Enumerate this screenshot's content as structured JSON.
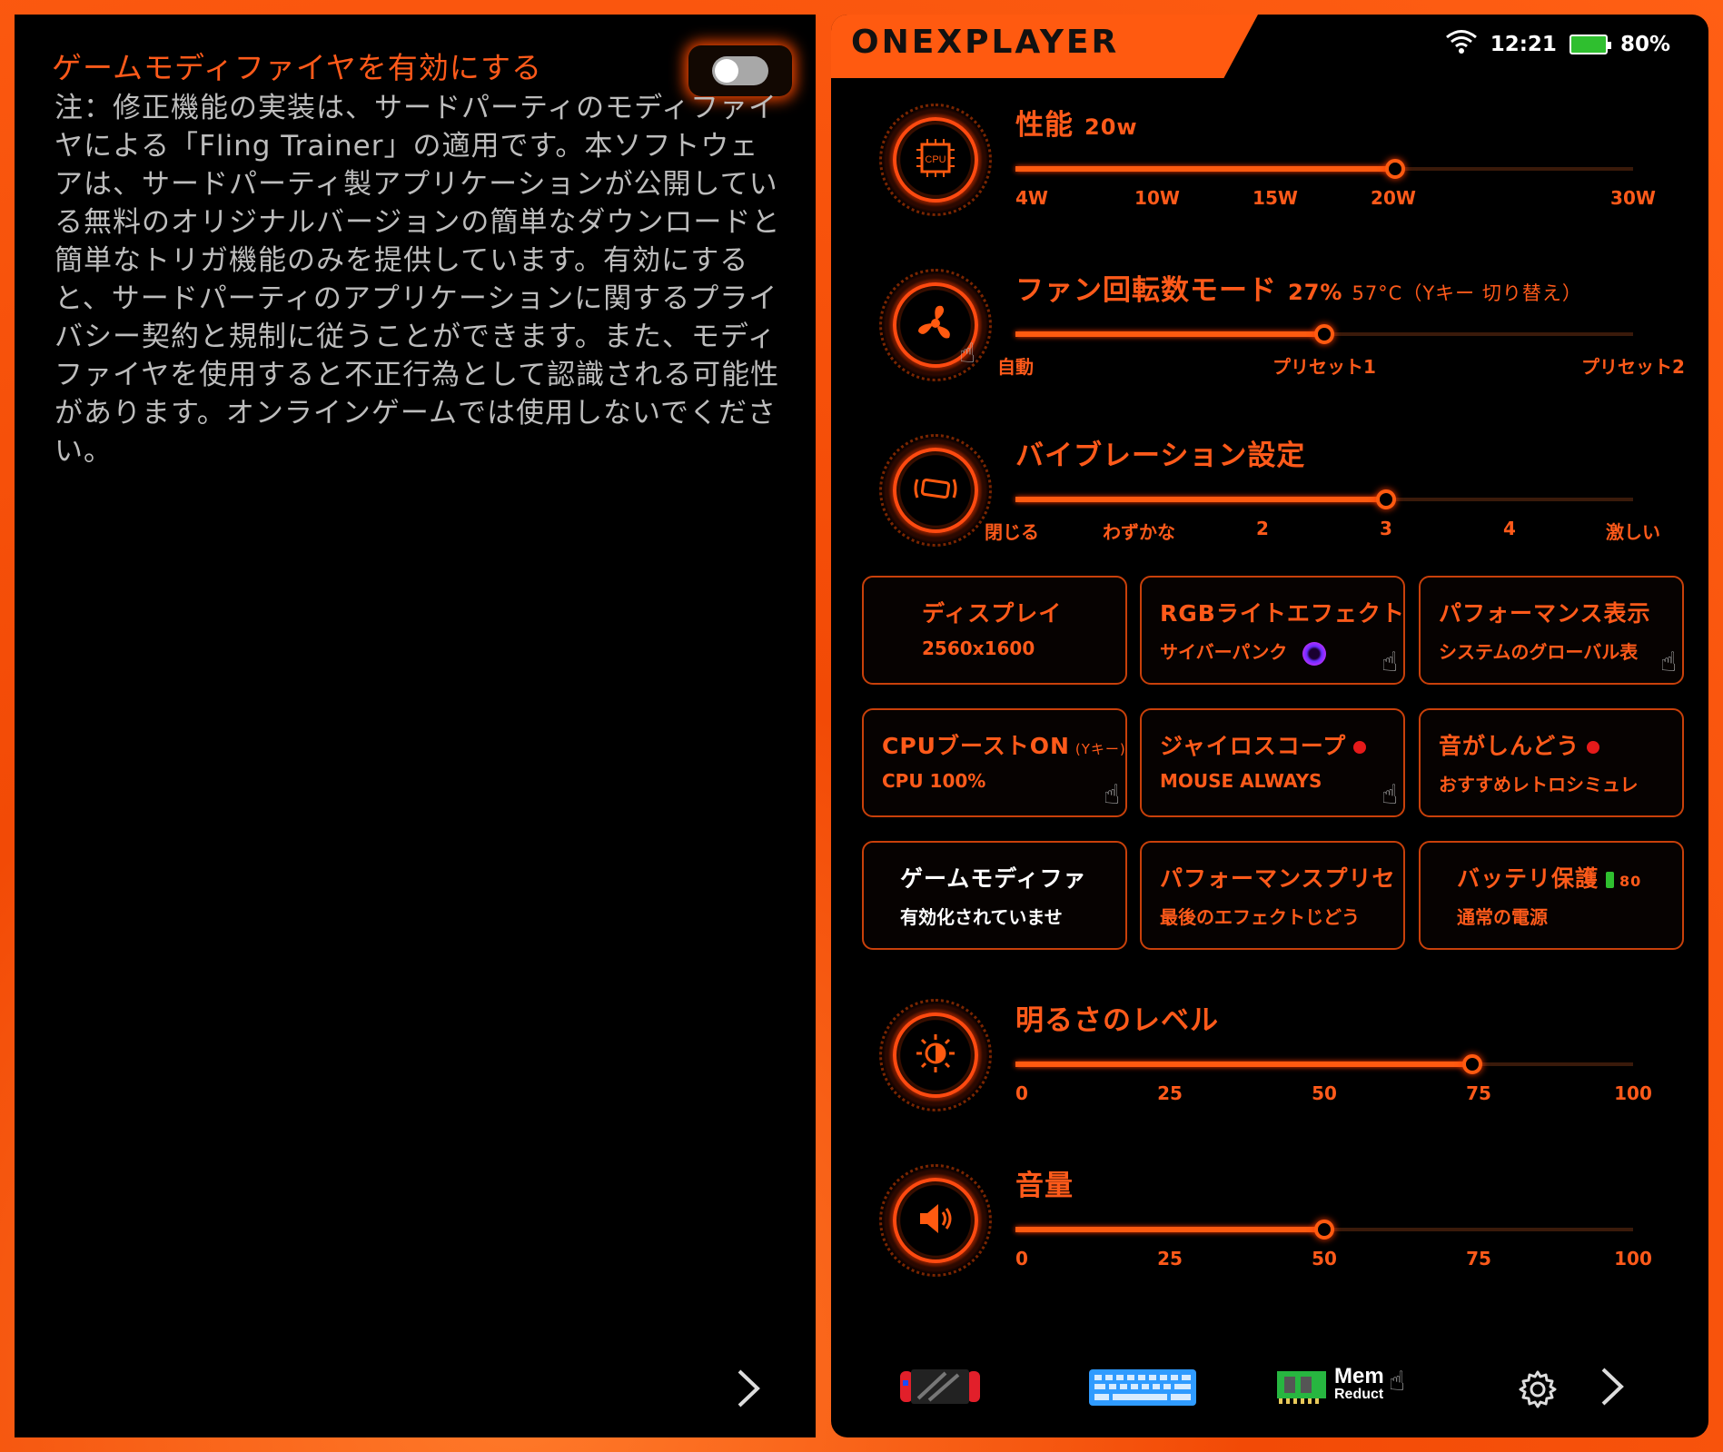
{
  "left": {
    "title": "ゲームモディファイヤを有効にする",
    "toggle_on": false,
    "body": "注：修正機能の実装は、サードパーティのモディファイヤによる「Fling Trainer」の適用です。本ソフトウェアは、サードパーティ製アプリケーションが公開している無料のオリジナルバージョンの簡単なダウンロードと簡単なトリガ機能のみを提供しています。有効にすると、サードパーティのアプリケーションに関するプライバシー契約と規制に従うことができます。また、モディファイヤを使用すると不正行為として認識される可能性があります。オンラインゲームでは使用しないでください。",
    "next_icon": "chevron-right-icon"
  },
  "header": {
    "logo": "ONEXPLAYER",
    "time": "12:21",
    "battery": "80%",
    "wifi_icon": "wifi-icon",
    "battery_icon": "battery-charging-icon"
  },
  "performance": {
    "title": "性能",
    "value": "20w",
    "ticks": [
      "4W",
      "10W",
      "15W",
      "20W",
      "30W"
    ],
    "level": 0.615,
    "icon": "cpu-icon"
  },
  "fan": {
    "title": "ファン回転数モード",
    "value": "27%",
    "sub": "57°C（Yキー 切り替え）",
    "ticks": [
      "自動",
      "プリセット1",
      "プリセット2"
    ],
    "level": 0.5,
    "icon": "fan-icon"
  },
  "vibration": {
    "title": "バイブレーション設定",
    "ticks": [
      "閉じる",
      "わずかな",
      "2",
      "3",
      "4",
      "激しい"
    ],
    "level": 0.6,
    "icon": "vibration-icon"
  },
  "cards": [
    {
      "title": "ディスプレイ",
      "value": "2560x1600"
    },
    {
      "title": "RGBライトエフェクト",
      "value": "サイバーパンク"
    },
    {
      "title": "パフォーマンス表示",
      "value": "システムのグローバル表"
    },
    {
      "title": "CPUブーストON",
      "title_suffix": "(Yキー)",
      "value": "CPU 100%"
    },
    {
      "title": "ジャイロスコープ",
      "value": "MOUSE ALWAYS"
    },
    {
      "title": "音がしんどう",
      "value": "おすすめレトロシミュレ"
    },
    {
      "title": "ゲームモディファ",
      "value": "有効化されていませ"
    },
    {
      "title": "パフォーマンスプリセ",
      "value": "最後のエフェクトじどう"
    },
    {
      "title": "バッテリ保護",
      "title_suffix": "80",
      "value": "通常の電源"
    }
  ],
  "brightness": {
    "title": "明るさのレベル",
    "ticks": [
      "0",
      "25",
      "50",
      "75",
      "100"
    ],
    "level": 0.74,
    "icon": "brightness-icon"
  },
  "volume": {
    "title": "音量",
    "ticks": [
      "0",
      "25",
      "50",
      "75",
      "100"
    ],
    "level": 0.5,
    "icon": "speaker-icon"
  },
  "bottom": {
    "mem_label_1": "Mem",
    "mem_label_2": "Reduct",
    "icons": [
      "game-console-icon",
      "keyboard-icon",
      "memory-chip-icon",
      "gear-icon",
      "chevron-right-icon"
    ]
  },
  "colors": {
    "accent": "#ff5a10",
    "frame": "#ff5a10",
    "panel": "#000000"
  }
}
